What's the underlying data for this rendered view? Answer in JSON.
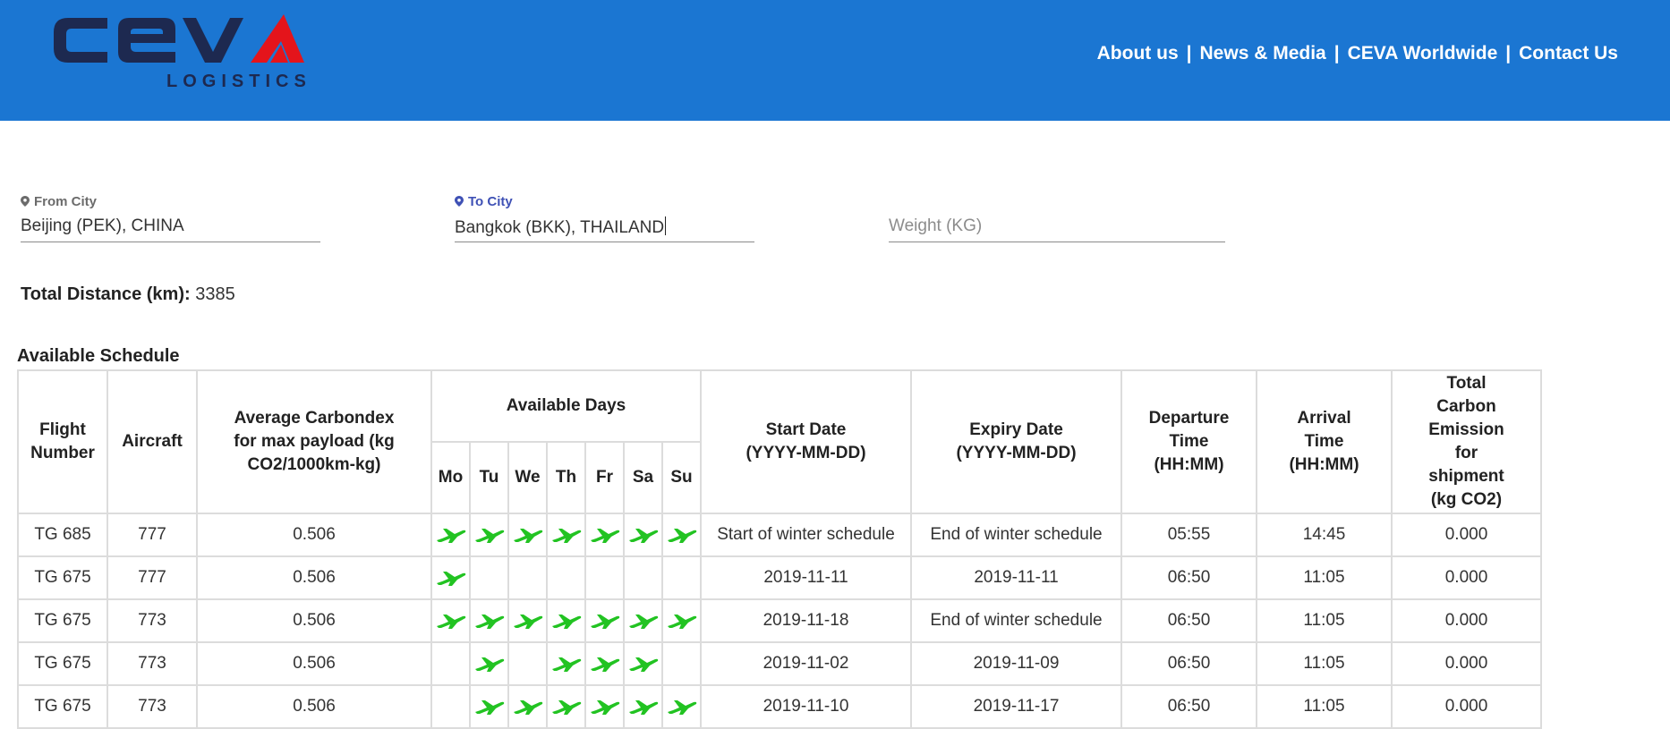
{
  "brand": {
    "name": "CEVA",
    "subtitle": "LOGISTICS",
    "colors": {
      "header_bg": "#1b76d2",
      "logo_dark": "#1d2950",
      "logo_red": "#e4141b",
      "check_green": "#22c322"
    }
  },
  "nav": {
    "links": [
      "About us",
      "News & Media",
      "CEVA Worldwide",
      "Contact Us"
    ],
    "separator": "|"
  },
  "form": {
    "from": {
      "label": "From City",
      "value": "Beijing (PEK), CHINA",
      "icon": "location-pin-icon"
    },
    "to": {
      "label": "To City",
      "value": "Bangkok (BKK), THAILAND",
      "icon": "location-pin-icon"
    },
    "weight": {
      "placeholder": "Weight (KG)",
      "value": ""
    }
  },
  "distance": {
    "label": "Total Distance (km):",
    "value": "3385"
  },
  "schedule": {
    "title": "Available Schedule",
    "headers": {
      "flight": "Flight Number",
      "aircraft": "Aircraft",
      "carbondex": "Average Carbondex for max payload (kg CO2/1000km-kg)",
      "days": "Available Days",
      "start": "Start Date (YYYY-MM-DD)",
      "expiry": "Expiry Date (YYYY-MM-DD)",
      "departure": "Departure Time (HH:MM)",
      "arrival": "Arrival Time (HH:MM)",
      "emission": "Total Carbon Emission for shipment (kg CO2)"
    },
    "day_labels": [
      "Mo",
      "Tu",
      "We",
      "Th",
      "Fr",
      "Sa",
      "Su"
    ],
    "rows": [
      {
        "flight": "TG 685",
        "aircraft": "777",
        "carbondex": "0.506",
        "days": [
          1,
          1,
          1,
          1,
          1,
          1,
          1
        ],
        "start": "Start of winter schedule",
        "expiry": "End of winter schedule",
        "departure": "05:55",
        "arrival": "14:45",
        "emission": "0.000"
      },
      {
        "flight": "TG 675",
        "aircraft": "777",
        "carbondex": "0.506",
        "days": [
          1,
          0,
          0,
          0,
          0,
          0,
          0
        ],
        "start": "2019-11-11",
        "expiry": "2019-11-11",
        "departure": "06:50",
        "arrival": "11:05",
        "emission": "0.000"
      },
      {
        "flight": "TG 675",
        "aircraft": "773",
        "carbondex": "0.506",
        "days": [
          1,
          1,
          1,
          1,
          1,
          1,
          1
        ],
        "start": "2019-11-18",
        "expiry": "End of winter schedule",
        "departure": "06:50",
        "arrival": "11:05",
        "emission": "0.000"
      },
      {
        "flight": "TG 675",
        "aircraft": "773",
        "carbondex": "0.506",
        "days": [
          0,
          1,
          0,
          1,
          1,
          1,
          0
        ],
        "start": "2019-11-02",
        "expiry": "2019-11-09",
        "departure": "06:50",
        "arrival": "11:05",
        "emission": "0.000"
      },
      {
        "flight": "TG 675",
        "aircraft": "773",
        "carbondex": "0.506",
        "days": [
          0,
          1,
          1,
          1,
          1,
          1,
          1
        ],
        "start": "2019-11-10",
        "expiry": "2019-11-17",
        "departure": "06:50",
        "arrival": "11:05",
        "emission": "0.000"
      }
    ]
  }
}
